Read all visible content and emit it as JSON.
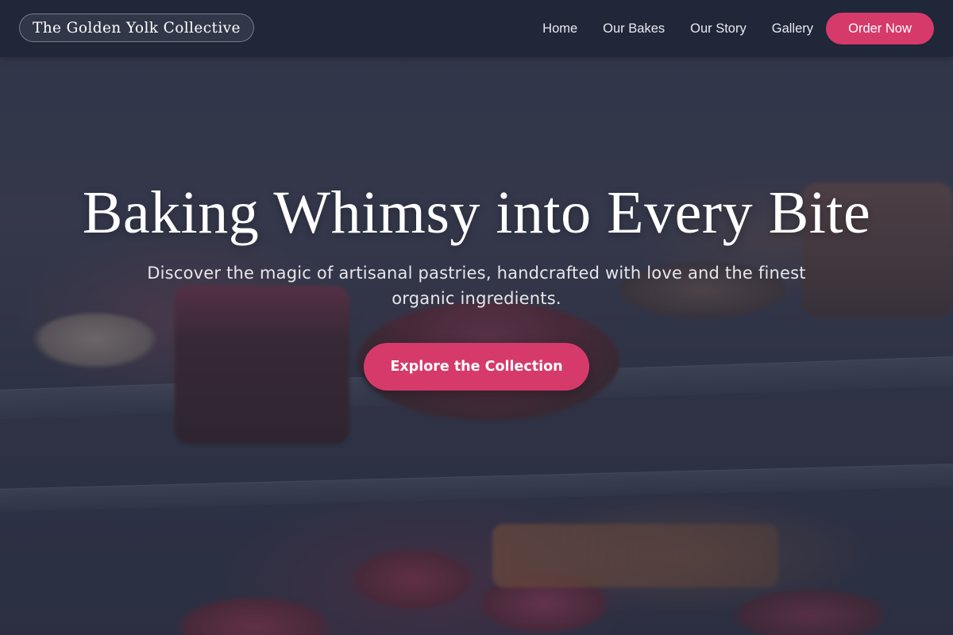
{
  "nav": {
    "brand": "The Golden Yolk Collective",
    "links": [
      {
        "label": "Home"
      },
      {
        "label": "Our Bakes"
      },
      {
        "label": "Our Story"
      },
      {
        "label": "Gallery"
      }
    ],
    "cta_label": "Order Now"
  },
  "hero": {
    "title": "Baking Whimsy into Every Bite",
    "subtitle": "Discover the magic of artisanal pastries, handcrafted with love and the finest organic ingredients.",
    "cta_label": "Explore the Collection"
  },
  "colors": {
    "nav_background": "#1e2638",
    "accent": "#d63a6b",
    "text_light": "#ffffff"
  }
}
